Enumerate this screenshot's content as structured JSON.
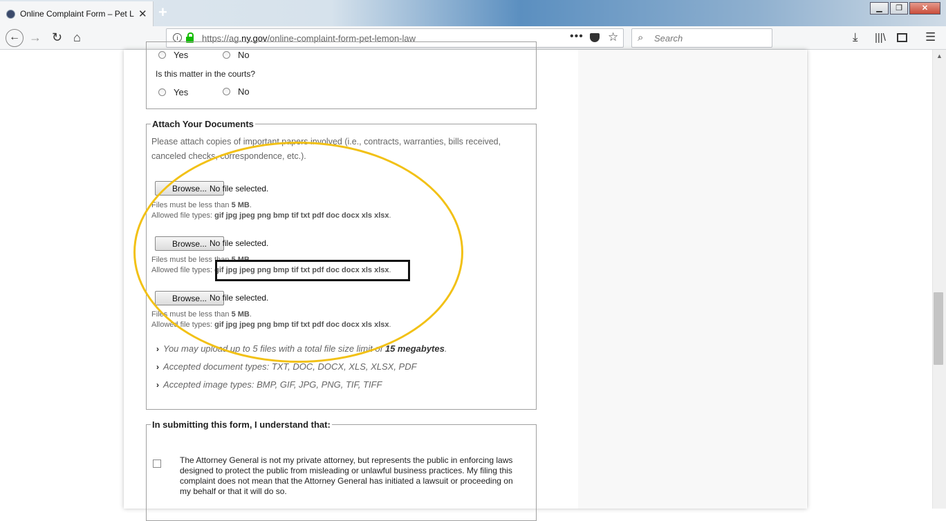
{
  "browser": {
    "tab_title": "Online Complaint Form – Pet Lemon Law",
    "new_tab_label": "+",
    "url_prefix": "https://ag.",
    "url_domain": "ny.gov",
    "url_path": "/online-complaint-form-pet-lemon-law",
    "search_placeholder": "Search",
    "window_buttons": {
      "minimize": "▁",
      "maximize": "❐",
      "close": "✕"
    }
  },
  "courts_section": {
    "prev_yes": "Yes",
    "prev_no": "No",
    "question": "Is this matter in the courts?",
    "yes": "Yes",
    "no": "No"
  },
  "attach": {
    "legend": "Attach Your Documents",
    "intro_line1": "Please attach copies of important papers involved (i.e., contracts, warranties, bills received,",
    "intro_line2": "canceled checks, correspondence, etc.).",
    "uploads": [
      {
        "button": "Browse...",
        "status": "No file selected.",
        "size_prefix": "Files must be less than ",
        "size_value": "5 MB",
        "size_suffix": ".",
        "types_prefix": "Allowed file types: ",
        "types_value": "gif jpg jpeg png bmp tif txt pdf doc docx xls xlsx",
        "types_suffix": "."
      },
      {
        "button": "Browse...",
        "status": "No file selected.",
        "size_prefix": "Files must be less than ",
        "size_value": "5 MB",
        "size_suffix": ".",
        "types_prefix": "Allowed file types: ",
        "types_value": "gif jpg jpeg png bmp tif txt pdf doc docx xls xlsx",
        "types_suffix": "."
      },
      {
        "button": "Browse...",
        "status": "No file selected.",
        "size_prefix": "Files must be less than ",
        "size_value": "5 MB",
        "size_suffix": ".",
        "types_prefix": "Allowed file types: ",
        "types_value": "gif jpg jpeg png bmp tif txt pdf doc docx xls xlsx",
        "types_suffix": "."
      }
    ],
    "note1_prefix": "You may upload up to 5 files with a total file size limit of ",
    "note1_bold": "15 megabytes",
    "note1_suffix": ".",
    "note2": "Accepted document types:  TXT, DOC, DOCX, XLS, XLSX, PDF",
    "note3": "Accepted image types:  BMP, GIF, JPG, PNG, TIF, TIFF",
    "chevron": "›"
  },
  "submit": {
    "legend": "In submitting this form, I understand that:",
    "item1": "The Attorney General is not my private attorney, but represents the public in enforcing laws designed to protect the public from misleading or unlawful business practices. My filing this complaint does not mean that the Attorney General has initiated a lawsuit or proceeding on my behalf or that it will do so."
  },
  "colors": {
    "annotation_ellipse": "#f2c116",
    "annotation_rect": "#111111",
    "lock_green": "#12bc00"
  }
}
